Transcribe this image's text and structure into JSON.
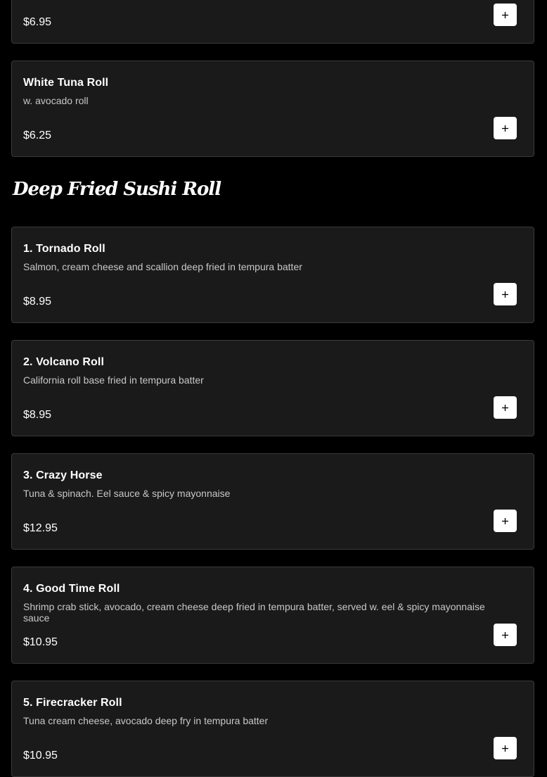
{
  "items_top": [
    {
      "name": "",
      "description": "",
      "price": "$6.95"
    },
    {
      "name": "White Tuna Roll",
      "description": "w. avocado roll",
      "price": "$6.25"
    }
  ],
  "section": {
    "title": "Deep Fried Sushi Roll"
  },
  "items": [
    {
      "name": "1. Tornado Roll",
      "description": "Salmon, cream cheese and scallion deep fried in tempura batter",
      "price": "$8.95"
    },
    {
      "name": "2. Volcano Roll",
      "description": "California roll base fried in tempura batter",
      "price": "$8.95"
    },
    {
      "name": "3. Crazy Horse",
      "description": "Tuna & spinach. Eel sauce & spicy mayonnaise",
      "price": "$12.95"
    },
    {
      "name": "4. Good Time Roll",
      "description": "Shrimp crab stick, avocado, cream cheese deep fried in tempura batter, served w. eel & spicy mayonnaise sauce",
      "price": "$10.95"
    },
    {
      "name": "5. Firecracker Roll",
      "description": "Tuna cream cheese, avocado deep fry in tempura batter",
      "price": "$10.95"
    }
  ],
  "icons": {
    "add": "plus-icon"
  },
  "colors": {
    "background": "#000000",
    "card": "#1a1a1a",
    "card_border": "#3a3a3a",
    "button": "#ffffff"
  }
}
